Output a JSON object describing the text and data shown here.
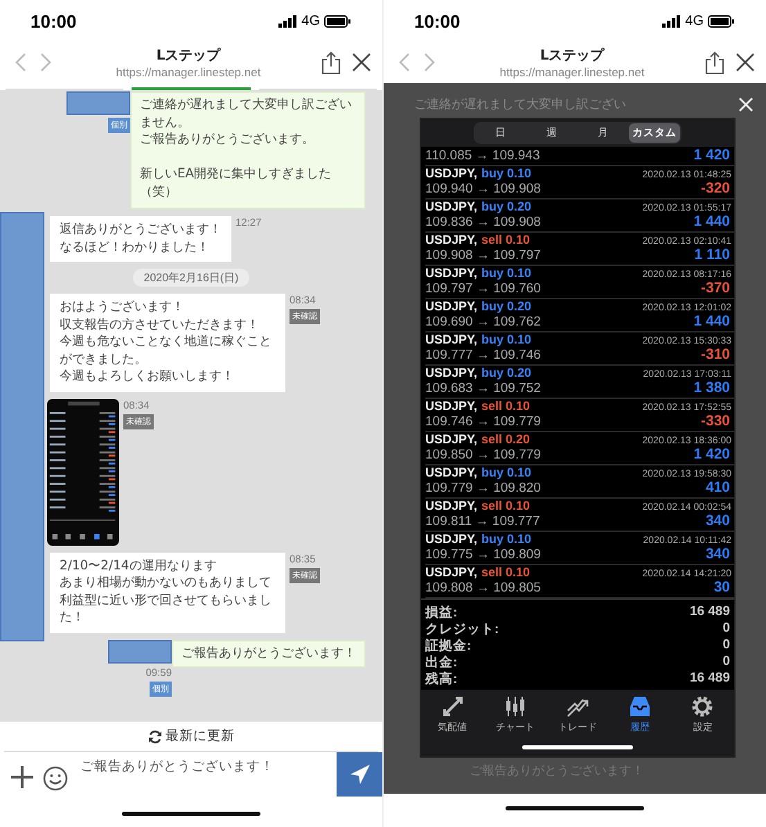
{
  "left_screen": {
    "status_bar": {
      "time": "10:00",
      "network": "4G"
    },
    "browser_bar": {
      "title": "Lステップ",
      "url": "https://manager.linestep.net"
    },
    "tabs": [
      {
        "selected": false
      },
      {
        "selected": true
      },
      {
        "selected": false
      }
    ],
    "messages": [
      {
        "kind": "outgoing",
        "blocks": [
          [
            "ご連絡が遅れまして大変申し訳ございません。",
            "ご報告ありがとうございます。"
          ],
          [
            "新しいEA開発に集中しすぎました（笑）"
          ]
        ],
        "badge": "個別"
      },
      {
        "kind": "incoming",
        "blocks": [
          [
            "返信ありがとうございます！",
            "なるほど！わかりました！"
          ]
        ],
        "time": "12:27"
      },
      {
        "kind": "date",
        "text": "2020年2月16日(日)"
      },
      {
        "kind": "incoming",
        "blocks": [
          [
            "おはようございます！",
            "収支報告の方させていただきます！",
            "今週も危ないことなく地道に稼ぐことができました。",
            "今週もよろしくお願いします！"
          ]
        ],
        "time": "08:34",
        "badge": "未確認"
      },
      {
        "kind": "image",
        "time": "08:34",
        "badge": "未確認"
      },
      {
        "kind": "incoming",
        "blocks": [
          [
            "2/10〜2/14の運用なります",
            "あまり相場が動かないのもありまして利益型に近い形で回させてもらいました！"
          ]
        ],
        "time": "08:35",
        "badge": "未確認"
      },
      {
        "kind": "outgoing",
        "blocks": [
          [
            "ご報告ありがとうございます！"
          ]
        ],
        "time": "09:59",
        "badge": "個別"
      }
    ],
    "refresh_button": "最新に更新",
    "composer": {
      "value": "ご報告ありがとうございます！"
    }
  },
  "right_screen": {
    "status_bar": {
      "time": "10:00",
      "network": "4G"
    },
    "browser_bar": {
      "title": "Lステップ",
      "url": "https://manager.linestep.net"
    },
    "background": {
      "message": "ご連絡が遅れまして大変申し訳ござい",
      "composer": "ご報告ありがとうございます！"
    },
    "modal": {
      "periods": [
        {
          "label": "日",
          "selected": false
        },
        {
          "label": "週",
          "selected": false
        },
        {
          "label": "月",
          "selected": false
        },
        {
          "label": "カスタム",
          "selected": true
        }
      ],
      "partial_trade": {
        "prices": "110.085 → 109.943",
        "profit": "1 420",
        "loss": false
      },
      "trades": [
        {
          "symbol": "USDJPY,",
          "side": "buy 0.10",
          "kind": "buy",
          "time": "2020.02.13 01:48:25",
          "prices": "109.940 → 109.908",
          "profit": "-320",
          "loss": true
        },
        {
          "symbol": "USDJPY,",
          "side": "buy 0.20",
          "kind": "buy",
          "time": "2020.02.13 01:55:17",
          "prices": "109.836 → 109.908",
          "profit": "1 440",
          "loss": false
        },
        {
          "symbol": "USDJPY,",
          "side": "sell 0.10",
          "kind": "sell",
          "time": "2020.02.13 02:10:41",
          "prices": "109.908 → 109.797",
          "profit": "1 110",
          "loss": false
        },
        {
          "symbol": "USDJPY,",
          "side": "buy 0.10",
          "kind": "buy",
          "time": "2020.02.13 08:17:16",
          "prices": "109.797 → 109.760",
          "profit": "-370",
          "loss": true
        },
        {
          "symbol": "USDJPY,",
          "side": "buy 0.20",
          "kind": "buy",
          "time": "2020.02.13 12:01:02",
          "prices": "109.690 → 109.762",
          "profit": "1 440",
          "loss": false
        },
        {
          "symbol": "USDJPY,",
          "side": "buy 0.10",
          "kind": "buy",
          "time": "2020.02.13 15:30:33",
          "prices": "109.777 → 109.746",
          "profit": "-310",
          "loss": true
        },
        {
          "symbol": "USDJPY,",
          "side": "buy 0.20",
          "kind": "buy",
          "time": "2020.02.13 17:03:11",
          "prices": "109.683 → 109.752",
          "profit": "1 380",
          "loss": false
        },
        {
          "symbol": "USDJPY,",
          "side": "sell 0.10",
          "kind": "sell",
          "time": "2020.02.13 17:52:55",
          "prices": "109.746 → 109.779",
          "profit": "-330",
          "loss": true
        },
        {
          "symbol": "USDJPY,",
          "side": "sell 0.20",
          "kind": "sell",
          "time": "2020.02.13 18:36:00",
          "prices": "109.850 → 109.779",
          "profit": "1 420",
          "loss": false
        },
        {
          "symbol": "USDJPY,",
          "side": "buy 0.10",
          "kind": "buy",
          "time": "2020.02.13 19:58:30",
          "prices": "109.779 → 109.820",
          "profit": "410",
          "loss": false
        },
        {
          "symbol": "USDJPY,",
          "side": "sell 0.10",
          "kind": "sell",
          "time": "2020.02.14 00:02:54",
          "prices": "109.811 → 109.777",
          "profit": "340",
          "loss": false
        },
        {
          "symbol": "USDJPY,",
          "side": "buy 0.10",
          "kind": "buy",
          "time": "2020.02.14 10:11:42",
          "prices": "109.775 → 109.809",
          "profit": "340",
          "loss": false
        },
        {
          "symbol": "USDJPY,",
          "side": "sell 0.10",
          "kind": "sell",
          "time": "2020.02.14 14:21:20",
          "prices": "109.808 → 109.805",
          "profit": "30",
          "loss": false
        }
      ],
      "summary": [
        {
          "label": "損益:",
          "value": "16 489"
        },
        {
          "label": "クレジット:",
          "value": "0"
        },
        {
          "label": "証拠金:",
          "value": "0"
        },
        {
          "label": "出金:",
          "value": "0"
        },
        {
          "label": "残高:",
          "value": "16 489"
        }
      ],
      "nav": [
        {
          "label": "気配値",
          "selected": false
        },
        {
          "label": "チャート",
          "selected": false
        },
        {
          "label": "トレード",
          "selected": false
        },
        {
          "label": "履歴",
          "selected": true
        },
        {
          "label": "設定",
          "selected": false
        }
      ]
    }
  }
}
